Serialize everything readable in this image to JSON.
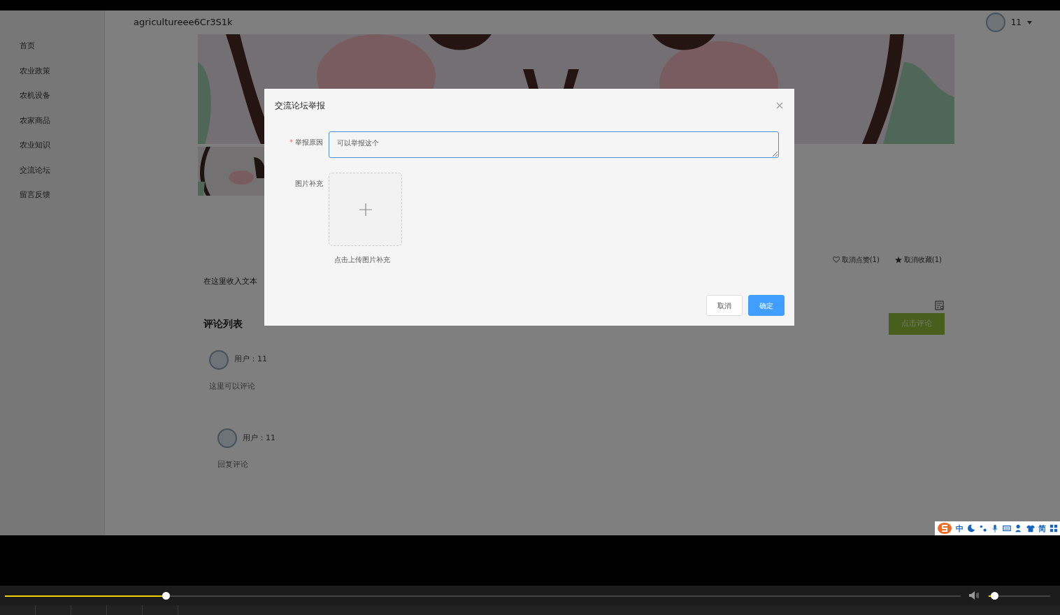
{
  "app": {
    "title": "agricultureee6Cr3S1k",
    "user": {
      "name": "11"
    }
  },
  "sidebar": {
    "items": [
      {
        "label": "首页"
      },
      {
        "label": "农业政策"
      },
      {
        "label": "农机设备"
      },
      {
        "label": "农家商品"
      },
      {
        "label": "农业知识"
      },
      {
        "label": "交流论坛"
      },
      {
        "label": "留言反馈"
      }
    ]
  },
  "post": {
    "like_button": "取消点赞(1)",
    "favorite_button": "取消收藏(1)",
    "body_text": "在这里收入文本",
    "comments_heading": "评论列表",
    "comment_button": "点击评论",
    "comments": [
      {
        "user": "用户：11",
        "text": "这里可以评论",
        "children": [
          {
            "user": "用户：11",
            "text": "回复评论"
          }
        ]
      }
    ]
  },
  "dialog": {
    "title": "交流论坛举报",
    "fields": [
      {
        "kind": "textarea",
        "label": "举报原因",
        "required_mark": "*",
        "value": "可以举报这个"
      },
      {
        "kind": "upload",
        "label": "图片补充",
        "hint": "点击上传图片补充"
      }
    ],
    "buttons": [
      {
        "label": "取消",
        "primary": false
      },
      {
        "label": "确定",
        "primary": true
      }
    ]
  },
  "ime_toolbar": {
    "items": [
      "中",
      "简"
    ]
  },
  "player": {
    "progress": {
      "level": 0.168
    },
    "volume": {
      "level": 0.09
    }
  }
}
